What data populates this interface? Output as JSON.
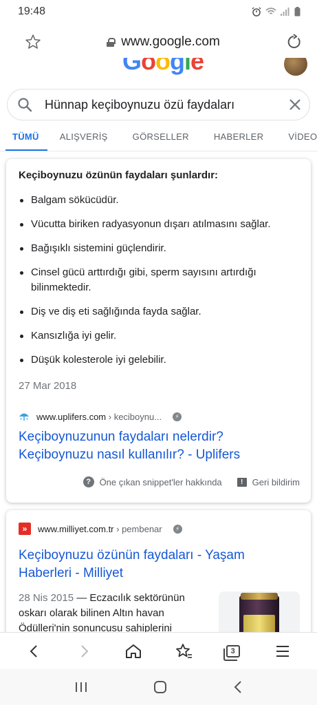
{
  "status_bar": {
    "time": "19:48",
    "icons": [
      "alarm-icon",
      "wifi-icon",
      "signal-icon",
      "battery-icon"
    ]
  },
  "browser": {
    "url": "www.google.com",
    "icons": {
      "left": "star-icon",
      "secure": "lock-icon",
      "right": "reload-icon"
    }
  },
  "google": {
    "logo_letters": [
      {
        "ch": "G",
        "color": "#4285F4"
      },
      {
        "ch": "o",
        "color": "#EA4335"
      },
      {
        "ch": "o",
        "color": "#FBBC05"
      },
      {
        "ch": "g",
        "color": "#4285F4"
      },
      {
        "ch": "l",
        "color": "#34A853"
      },
      {
        "ch": "e",
        "color": "#EA4335"
      }
    ]
  },
  "search": {
    "query": "Hünnap keçiboynuzu özü faydaları"
  },
  "tabs": [
    {
      "label": "TÜMÜ",
      "active": true
    },
    {
      "label": "ALIŞVERİŞ",
      "active": false
    },
    {
      "label": "GÖRSELLER",
      "active": false
    },
    {
      "label": "HABERLER",
      "active": false
    },
    {
      "label": "VİDEOLAR",
      "active": false
    }
  ],
  "featured_snippet": {
    "title": "Keçiboynuzu özünün faydaları şunlardır:",
    "bullets": [
      "Balgam sökücüdür.",
      "Vücutta biriken radyasyonun dışarı atılmasını sağlar.",
      "Bağışıklı sistemini güçlendirir.",
      "Cinsel gücü arttırdığı gibi, sperm sayısını artırdığı bilinmektedir.",
      "Diş ve diş eti sağlığında fayda sağlar.",
      "Kansızlığa iyi gelir.",
      "Düşük kolesterole iyi gelebilir."
    ],
    "date": "27 Mar 2018",
    "source_domain": "www.uplifers.com",
    "source_crumb": " › keciboynu...",
    "link_title": "Keçiboynuzunun faydaları nelerdir? Keçiboynuzu nasıl kullanılır? - Uplifers",
    "footer_about": "Öne çıkan snippet'ler hakkında",
    "footer_feedback": "Geri bildirim"
  },
  "result2": {
    "source_domain": "www.milliyet.com.tr",
    "source_crumb": " › pembenar",
    "link_title": "Keçiboynuzu özünün faydaları - Yaşam Haberleri - Milliyet",
    "date": "28 Nis 2015",
    "snippet": " — Eczacılık sektörünün oskarı olarak bilinen Altın havan Ödülleri'nin sonuncusu sahiplerini"
  },
  "toolbar": {
    "icons": [
      "back-icon",
      "forward-icon",
      "home-icon",
      "bookmark-star-icon",
      "tabs-icon",
      "menu-icon"
    ],
    "tab_count": "3"
  },
  "nav": {
    "icons": [
      "recents-icon",
      "home-nav-icon",
      "back-nav-icon"
    ]
  }
}
